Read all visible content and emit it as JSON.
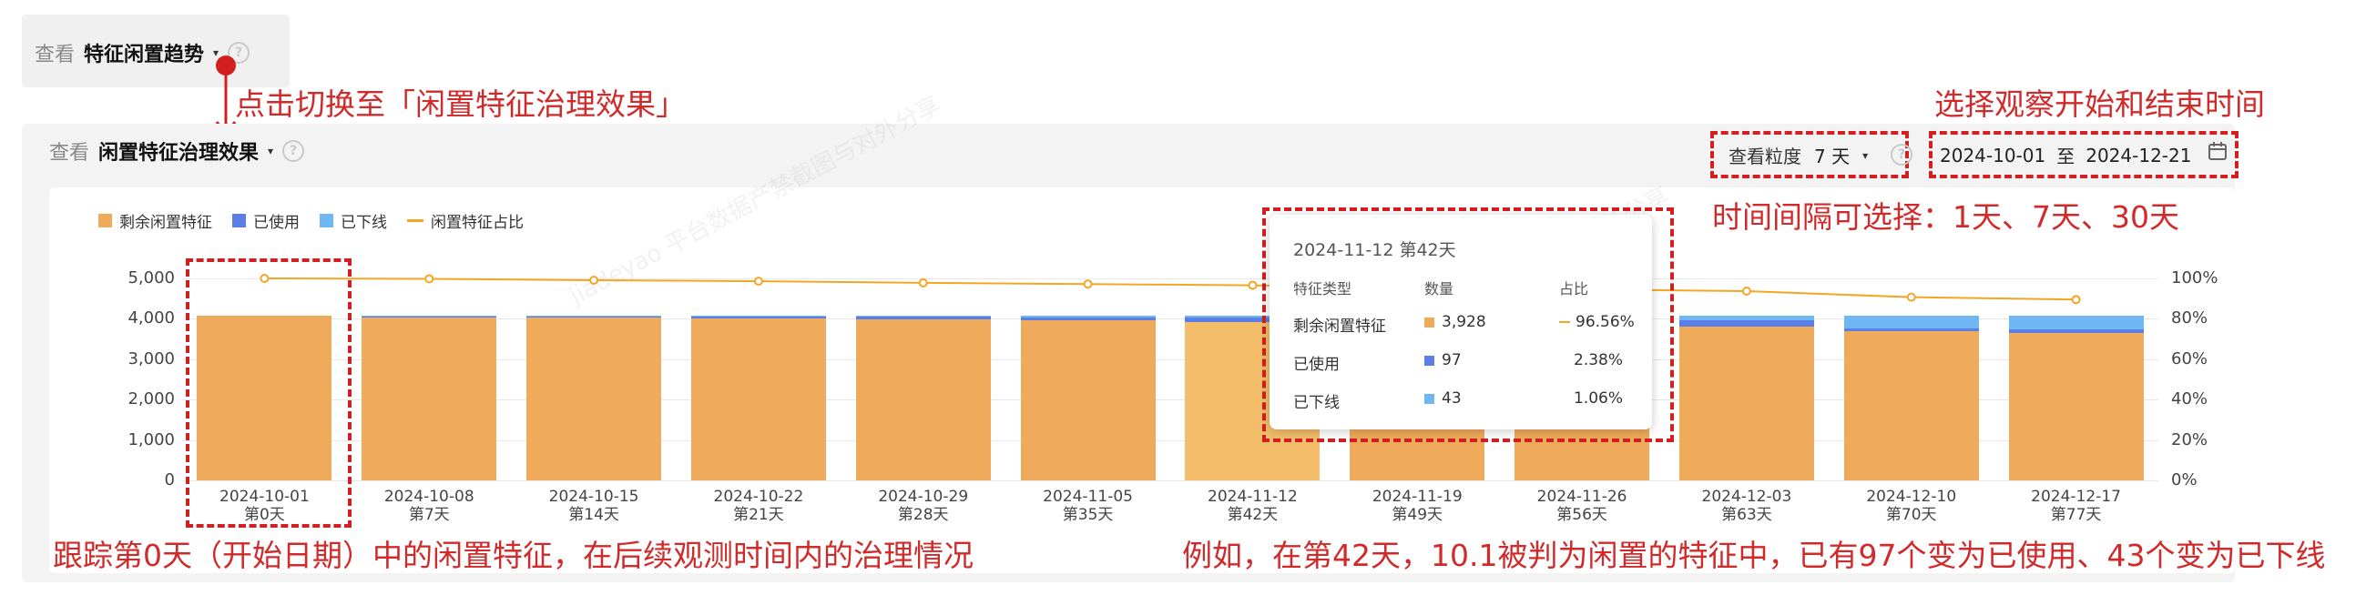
{
  "top_selector": {
    "prefix": "查看",
    "value": "特征闲置趋势",
    "caret": "▾",
    "help": "?"
  },
  "annotations": {
    "switch": "点击切换至「闲置特征治理效果」",
    "date_range": "选择观察开始和结束时间",
    "interval": "时间间隔可选择：1天、7天、30天",
    "track": "跟踪第0天（开始日期）中的闲置特征，在后续观测时间内的治理情况",
    "example": "例如，在第42天，10.1被判为闲置的特征中，已有97个变为已使用、43个变为已下线"
  },
  "panel": {
    "prefix": "查看",
    "view_value": "闲置特征治理效果",
    "caret": "▾",
    "help": "?",
    "granularity_label": "查看粒度",
    "granularity_value": "7 天",
    "granularity_caret": "▾",
    "date_start": "2024-10-01",
    "date_sep": "至",
    "date_end": "2024-12-21",
    "calendar_icon": "calendar-icon"
  },
  "watermark": "jiadeyao 平台数据产禁截图与对外分享",
  "colors": {
    "remaining": "#f0aa5b",
    "used": "#5b7fe6",
    "offline": "#6fb7f2",
    "ratio": "#f5a524",
    "annotation": "#d21f1f"
  },
  "chart_data": {
    "type": "bar",
    "stacked": true,
    "legend": [
      "剩余闲置特征",
      "已使用",
      "已下线",
      "闲置特征占比"
    ],
    "legend_position": "top-left",
    "categories": [
      "2024-10-01",
      "2024-10-08",
      "2024-10-15",
      "2024-10-22",
      "2024-10-29",
      "2024-11-05",
      "2024-11-12",
      "2024-11-19",
      "2024-11-26",
      "2024-12-03",
      "2024-12-10",
      "2024-12-17"
    ],
    "sub_labels": [
      "第0天",
      "第7天",
      "第14天",
      "第21天",
      "第28天",
      "第35天",
      "第42天",
      "第49天",
      "第56天",
      "第63天",
      "第70天",
      "第77天"
    ],
    "series": [
      {
        "name": "剩余闲置特征",
        "values": [
          4068,
          4060,
          4030,
          4010,
          3980,
          3955,
          3928,
          3880,
          3850,
          3810,
          3690,
          3640
        ]
      },
      {
        "name": "已使用",
        "values": [
          0,
          5,
          25,
          45,
          65,
          80,
          97,
          120,
          140,
          160,
          80,
          90
        ]
      },
      {
        "name": "已下线",
        "values": [
          0,
          3,
          13,
          13,
          23,
          33,
          43,
          68,
          78,
          98,
          298,
          338
        ]
      },
      {
        "name": "闲置特征占比",
        "axis": "right",
        "values": [
          100,
          99.8,
          99.1,
          98.6,
          97.8,
          97.2,
          96.56,
          95.4,
          94.6,
          93.7,
          90.7,
          89.5
        ]
      }
    ],
    "ylim_left": [
      0,
      5000
    ],
    "yticks_left": [
      "0",
      "1,000",
      "2,000",
      "3,000",
      "4,000",
      "5,000"
    ],
    "ylim_right": [
      0,
      100
    ],
    "yticks_right": [
      "0%",
      "20%",
      "40%",
      "60%",
      "80%",
      "100%"
    ],
    "grid": true,
    "highlight_index": 6
  },
  "tooltip": {
    "title": "2024-11-12 第42天",
    "col_type": "特征类型",
    "col_count": "数量",
    "col_ratio": "占比",
    "rows": [
      {
        "type": "剩余闲置特征",
        "count": "3,928",
        "ratio": "96.56%"
      },
      {
        "type": "已使用",
        "count": "97",
        "ratio": "2.38%"
      },
      {
        "type": "已下线",
        "count": "43",
        "ratio": "1.06%"
      }
    ]
  }
}
